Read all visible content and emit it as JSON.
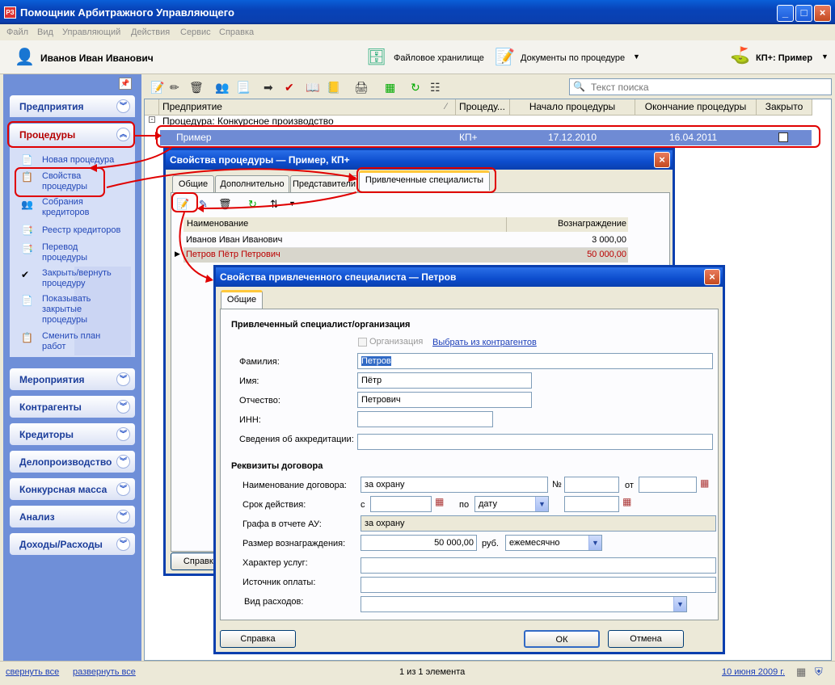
{
  "window": {
    "title": "Помощник Арбитражного Управляющего",
    "icon_text": "РЗ"
  },
  "menu": [
    "Файл",
    "Вид",
    "Управляющий",
    "Действия",
    "Сервис",
    "Справка"
  ],
  "user": {
    "name": "Иванов Иван Иванович"
  },
  "toolbar": {
    "file_storage": "Файловое хранилище",
    "documents": "Документы по процедуре",
    "procedure": "КП+: Пример"
  },
  "sidebar": {
    "sections_top": [
      {
        "label": "Предприятия"
      },
      {
        "label": "Процедуры"
      }
    ],
    "procedure_items": [
      "Новая процедура",
      "Свойства процедуры",
      "Собрания кредиторов",
      "Реестр кредиторов",
      "Перевод процедуры",
      "Закрыть/вернуть процедуру",
      "Показывать закрытые процедуры",
      "Сменить план работ"
    ],
    "sections_bottom": [
      "Мероприятия",
      "Контрагенты",
      "Кредиторы",
      "Делопроизводство",
      "Конкурсная масса",
      "Анализ",
      "Доходы/Расходы"
    ]
  },
  "search": {
    "placeholder": "Текст поиска"
  },
  "grid": {
    "columns": [
      "Предприятие",
      "Процеду...",
      "Начало процедуры",
      "Окончание процедуры",
      "Закрыто"
    ],
    "group": "Процедура: Конкурсное производство",
    "row": {
      "name": "Пример",
      "type": "КП+",
      "start": "17.12.2010",
      "end": "16.04.2011"
    }
  },
  "dialog1": {
    "title": "Свойства процедуры — Пример, КП+",
    "tabs": [
      "Общие",
      "Дополнительно",
      "Представители",
      "Привлеченные специалисты"
    ],
    "columns": [
      "Наименование",
      "Вознаграждение"
    ],
    "rows": [
      {
        "name": "Иванов Иван Иванович",
        "fee": "3 000,00"
      },
      {
        "name": "Петров Пётр Петрович",
        "fee": "50 000,00"
      }
    ],
    "help_button": "Справка"
  },
  "dialog2": {
    "title": "Свойства привлеченного специалиста — Петров",
    "tab": "Общие",
    "section1": "Привлеченный специалист/организация",
    "org_checkbox": "Организация",
    "choose_link": "Выбрать из контрагентов",
    "fields": {
      "surname_label": "Фамилия:",
      "surname": "Петров",
      "name_label": "Имя:",
      "name": "Пётр",
      "patronymic_label": "Отчество:",
      "patronymic": "Петрович",
      "inn_label": "ИНН:",
      "inn": "",
      "accred_label": "Сведения об аккредитации:",
      "accred": ""
    },
    "section2": "Реквизиты договора",
    "contract": {
      "name_label": "Наименование договора:",
      "name": "за охрану",
      "no_label": "№",
      "no": "",
      "from_label": "от",
      "from": "",
      "period_label": "Срок действия:",
      "s_label": "с",
      "s": "",
      "po_label": "по",
      "po_select": "дату",
      "po": "",
      "report_label": "Графа в отчете АУ:",
      "report": "за охрану",
      "fee_label": "Размер вознаграждения:",
      "fee": "50 000,00",
      "currency": "руб.",
      "period_select": "ежемесячно",
      "nature_label": "Характер услуг:",
      "nature": "",
      "source_label": "Источник оплаты:",
      "source": "",
      "expense_label": "Вид расходов:",
      "expense": ""
    },
    "buttons": {
      "help": "Справка",
      "ok": "ОК",
      "cancel": "Отмена"
    }
  },
  "status": {
    "collapse": "свернуть все",
    "expand": "развернуть все",
    "count": "1 из 1 элемента",
    "date": "10 июня 2009 г."
  }
}
